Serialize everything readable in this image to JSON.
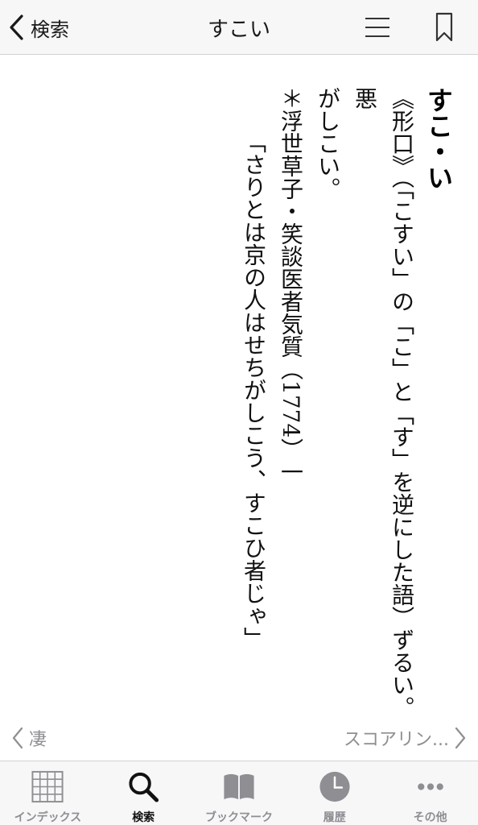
{
  "header": {
    "back_label": "検索",
    "title": "すこい"
  },
  "entry": {
    "headword": "すこ・い",
    "definition_lines": [
      "《形口》（「こすい」の「こ」と「す」を逆にした語）ずるい。悪",
      "がしこい。"
    ],
    "example_source": "＊浮世草子・笑談医者気質（1774）一",
    "example_quote": "「さりとは京の人はせちがしこう、すこひ者じゃ」"
  },
  "nav": {
    "prev_label": "凄",
    "next_label": "スコアリン..."
  },
  "tabbar": {
    "tabs": [
      {
        "label": "インデックス",
        "icon": "grid-icon"
      },
      {
        "label": "検索",
        "icon": "search-icon",
        "active": true
      },
      {
        "label": "ブックマーク",
        "icon": "book-icon"
      },
      {
        "label": "履歴",
        "icon": "clock-icon"
      },
      {
        "label": "その他",
        "icon": "more-icon"
      }
    ]
  },
  "colors": {
    "bar_background": "#f7f7f8",
    "inactive_gray": "#8e8e93",
    "active_black": "#111111"
  }
}
